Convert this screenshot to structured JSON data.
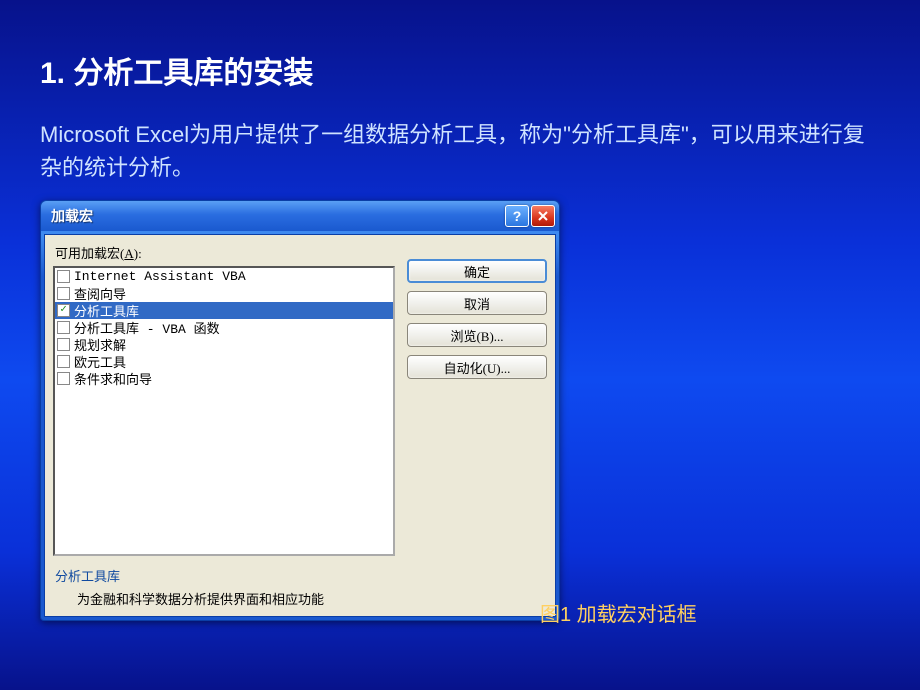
{
  "slide": {
    "title": "1. 分析工具库的安装",
    "body": "Microsoft Excel为用户提供了一组数据分析工具，称为\"分析工具库\"，可以用来进行复杂的统计分析。",
    "caption": "图1  加载宏对话框"
  },
  "dialog": {
    "title": "加载宏",
    "list_label": "可用加载宏(",
    "list_label_accel": "A",
    "list_label_tail": "):",
    "items": [
      {
        "label": "Internet Assistant VBA",
        "checked": false,
        "selected": false
      },
      {
        "label": "查阅向导",
        "checked": false,
        "selected": false
      },
      {
        "label": "分析工具库",
        "checked": true,
        "selected": true
      },
      {
        "label": "分析工具库 - VBA 函数",
        "checked": false,
        "selected": false
      },
      {
        "label": "规划求解",
        "checked": false,
        "selected": false
      },
      {
        "label": "欧元工具",
        "checked": false,
        "selected": false
      },
      {
        "label": "条件求和向导",
        "checked": false,
        "selected": false
      }
    ],
    "buttons": {
      "ok": "确定",
      "cancel": "取消",
      "browse": "浏览(B)...",
      "automation": "自动化(U)..."
    },
    "description": {
      "title": "分析工具库",
      "text": "为金融和科学数据分析提供界面和相应功能"
    }
  }
}
